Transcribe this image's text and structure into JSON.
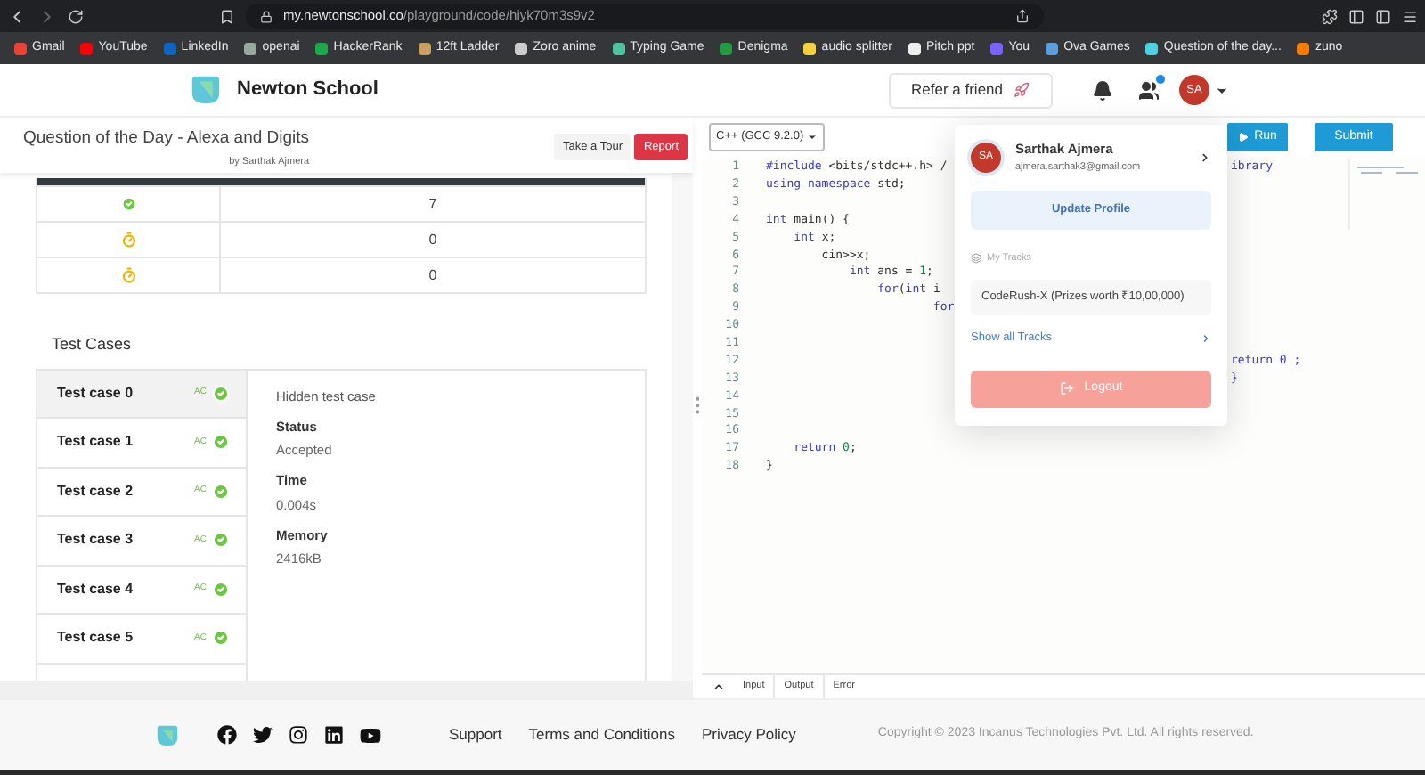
{
  "browser": {
    "url_domain": "my.newtonschool.co",
    "url_path": "/playground/code/hiyk70m3s9v2",
    "bookmarks": [
      {
        "label": "Gmail",
        "color": "#ea4335"
      },
      {
        "label": "YouTube",
        "color": "#ff0000"
      },
      {
        "label": "LinkedIn",
        "color": "#0a66c2"
      },
      {
        "label": "openai",
        "color": "#9aa9a0"
      },
      {
        "label": "HackerRank",
        "color": "#1ba94c"
      },
      {
        "label": "12ft Ladder",
        "color": "#c8a060"
      },
      {
        "label": "Zoro anime",
        "color": "#cccccc"
      },
      {
        "label": "Typing Game",
        "color": "#4fc3a1"
      },
      {
        "label": "Denigma",
        "color": "#1e9e3e"
      },
      {
        "label": "audio splitter",
        "color": "#f4d03f"
      },
      {
        "label": "Pitch ppt",
        "color": "#eeeeee"
      },
      {
        "label": "You",
        "color": "#7b61ff"
      },
      {
        "label": "Ova Games",
        "color": "#5aa0e0"
      },
      {
        "label": "Question of the day...",
        "color": "#4dd0e1"
      },
      {
        "label": "zuno",
        "color": "#f57c00"
      }
    ]
  },
  "header": {
    "brand": "Newton School",
    "refer": "Refer a friend",
    "avatar": "SA",
    "notification_dot": true
  },
  "problem": {
    "title": "Question of the Day - Alexa and Digits",
    "author": "by Sarthak Ajmera",
    "tour_button": "Take a Tour",
    "report_button": "Report"
  },
  "results": [
    {
      "kind": "accepted",
      "value": "7"
    },
    {
      "kind": "pending",
      "value": "0"
    },
    {
      "kind": "pending",
      "value": "0"
    }
  ],
  "test_cases": {
    "heading": "Test Cases",
    "items": [
      {
        "label": "Test case 0",
        "verdict": "AC",
        "kind": "accepted",
        "selected": true
      },
      {
        "label": "Test case 1",
        "verdict": "AC",
        "kind": "accepted",
        "selected": false
      },
      {
        "label": "Test case 2",
        "verdict": "AC",
        "kind": "accepted",
        "selected": false
      },
      {
        "label": "Test case 3",
        "verdict": "AC",
        "kind": "accepted",
        "selected": false
      },
      {
        "label": "Test case 4",
        "verdict": "AC",
        "kind": "accepted",
        "selected": false
      },
      {
        "label": "Test case 5",
        "verdict": "AC",
        "kind": "accepted",
        "selected": false
      }
    ],
    "detail": {
      "heading": "Hidden test case",
      "fields": [
        {
          "label": "Status",
          "value": "Accepted"
        },
        {
          "label": "Time",
          "value": "0.004s"
        },
        {
          "label": "Memory",
          "value": "2416kB"
        }
      ]
    }
  },
  "editor": {
    "language": "C++ (GCC 9.2.0)",
    "run": "Run",
    "submit": "Submit",
    "lines": [
      {
        "number": "1",
        "segments": [
          {
            "text": "#include",
            "kind": "keyword"
          },
          {
            "text": " <bits/stdc++.h> /",
            "kind": "plain"
          }
        ],
        "tail": "ibrary"
      },
      {
        "number": "2",
        "segments": [
          {
            "text": "using namespace",
            "kind": "keyword"
          },
          {
            "text": " std;",
            "kind": "plain"
          }
        ]
      },
      {
        "number": "3"
      },
      {
        "number": "4",
        "segments": [
          {
            "text": "int",
            "kind": "keyword"
          },
          {
            "text": " main() {",
            "kind": "plain"
          }
        ]
      },
      {
        "number": "5",
        "segments": [
          {
            "text": "    int",
            "kind": "keyword"
          },
          {
            "text": " x;",
            "kind": "plain"
          }
        ]
      },
      {
        "number": "6",
        "segments": [
          {
            "text": "        cin>>x;",
            "kind": "plain"
          }
        ]
      },
      {
        "number": "7",
        "segments": [
          {
            "text": "            int",
            "kind": "keyword"
          },
          {
            "text": " ans = ",
            "kind": "plain"
          },
          {
            "text": "1",
            "kind": "number"
          },
          {
            "text": ";",
            "kind": "plain"
          }
        ]
      },
      {
        "number": "8",
        "segments": [
          {
            "text": "                for",
            "kind": "keyword"
          },
          {
            "text": "(",
            "kind": "plain"
          },
          {
            "text": "int",
            "kind": "keyword"
          },
          {
            "text": " i",
            "kind": "plain"
          }
        ]
      },
      {
        "number": "9",
        "segments": [
          {
            "text": "                        for",
            "kind": "keyword"
          }
        ]
      },
      {
        "number": "10"
      },
      {
        "number": "11"
      },
      {
        "number": "12",
        "tail": "return 0 ;"
      },
      {
        "number": "13",
        "tail": "}"
      },
      {
        "number": "14"
      },
      {
        "number": "15"
      },
      {
        "number": "16"
      },
      {
        "number": "17",
        "segments": [
          {
            "text": "    return",
            "kind": "keyword"
          },
          {
            "text": " 0",
            "kind": "number"
          },
          {
            "text": ";",
            "kind": "plain"
          }
        ]
      },
      {
        "number": "18",
        "segments": [
          {
            "text": "}",
            "kind": "plain"
          }
        ]
      }
    ],
    "bottom_tabs": [
      "Input",
      "Output",
      "Error"
    ]
  },
  "profile_menu": {
    "avatar": "SA",
    "name": "Sarthak Ajmera",
    "email": "ajmera.sarthak3@gmail.com",
    "update_button": "Update Profile",
    "tracks_heading": "My Tracks",
    "tracks": [
      "CodeRush-X (Prizes worth ₹10,00,000)"
    ],
    "show_all": "Show all Tracks",
    "logout": "Logout"
  },
  "footer": {
    "links": [
      "Support",
      "Terms and Conditions",
      "Privacy Policy"
    ],
    "copyright": "Copyright © 2023 Incanus Technologies Pvt. Ltd. All rights reserved."
  }
}
